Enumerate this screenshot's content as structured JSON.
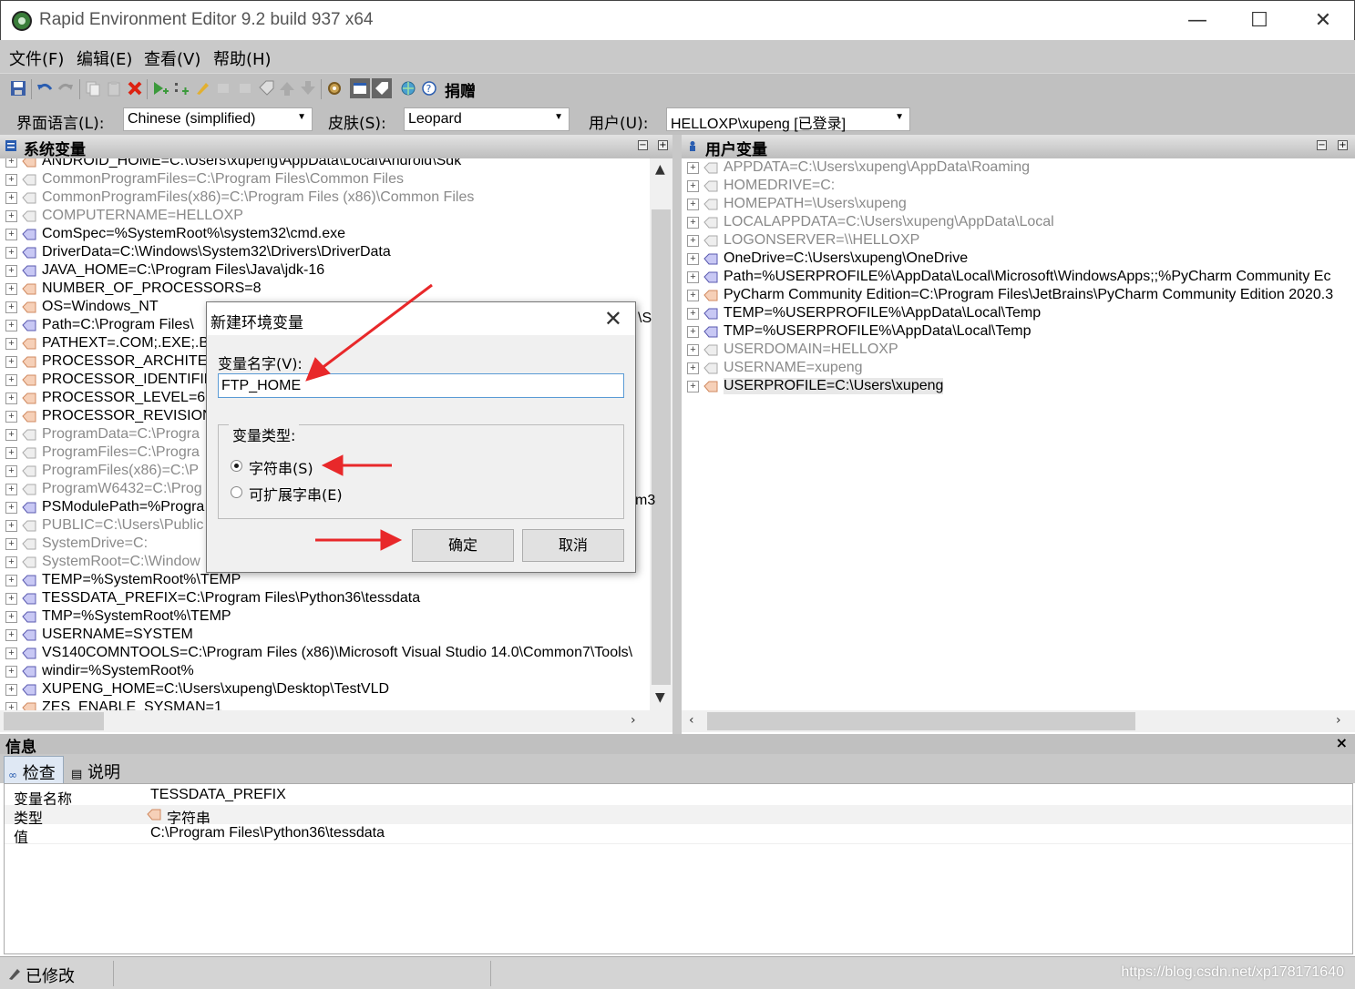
{
  "window": {
    "title": "Rapid Environment Editor 9.2 build 937 x64",
    "minimize": "—",
    "maximize": "☐",
    "close": "✕"
  },
  "menu": [
    "文件(F)",
    "编辑(E)",
    "查看(V)",
    "帮助(H)"
  ],
  "toolbar": {
    "donate": "捐赠",
    "icons": [
      "save-icon",
      "undo-icon",
      "redo-icon",
      "copy-icon",
      "paste-icon",
      "delete-icon",
      "add-variable-icon",
      "add-value-icon",
      "edit-icon",
      "copy-value-icon",
      "paste-value-icon",
      "tag-icon",
      "move-up-icon",
      "move-down-icon",
      "settings-icon",
      "view-icon",
      "tag-view-icon",
      "globe-icon",
      "help-icon"
    ]
  },
  "options": {
    "language_label": "界面语言(L):",
    "language_value": "Chinese (simplified)",
    "skin_label": "皮肤(S):",
    "skin_value": "Leopard",
    "user_label": "用户(U):",
    "user_value": "HELLOXP\\xupeng [已登录]"
  },
  "system_panel": {
    "title": "系统变量",
    "rows": [
      {
        "text": "ANDROID_HOME=C:\\Users\\xupeng\\AppData\\Local\\Android\\Sdk",
        "dim": false
      },
      {
        "text": "CommonProgramFiles=C:\\Program Files\\Common Files",
        "dim": true
      },
      {
        "text": "CommonProgramFiles(x86)=C:\\Program Files (x86)\\Common Files",
        "dim": true
      },
      {
        "text": "COMPUTERNAME=HELLOXP",
        "dim": true
      },
      {
        "text": "ComSpec=%SystemRoot%\\system32\\cmd.exe",
        "dim": false
      },
      {
        "text": "DriverData=C:\\Windows\\System32\\Drivers\\DriverData",
        "dim": false
      },
      {
        "text": "JAVA_HOME=C:\\Program Files\\Java\\jdk-16",
        "dim": false
      },
      {
        "text": "NUMBER_OF_PROCESSORS=8",
        "dim": false
      },
      {
        "text": "OS=Windows_NT",
        "dim": false
      },
      {
        "text": "Path=C:\\Program Files\\",
        "dim": false
      },
      {
        "text": "PATHEXT=.COM;.EXE;.B",
        "dim": false
      },
      {
        "text": "PROCESSOR_ARCHITEC",
        "dim": false
      },
      {
        "text": "PROCESSOR_IDENTIFIE",
        "dim": false
      },
      {
        "text": "PROCESSOR_LEVEL=6",
        "dim": false
      },
      {
        "text": "PROCESSOR_REVISION=",
        "dim": false
      },
      {
        "text": "ProgramData=C:\\Progra",
        "dim": true
      },
      {
        "text": "ProgramFiles=C:\\Progra",
        "dim": true
      },
      {
        "text": "ProgramFiles(x86)=C:\\P",
        "dim": true
      },
      {
        "text": "ProgramW6432=C:\\Prog",
        "dim": true
      },
      {
        "text": "PSModulePath=%Progra",
        "dim": false
      },
      {
        "text": "PUBLIC=C:\\Users\\Public",
        "dim": true
      },
      {
        "text": "SystemDrive=C:",
        "dim": true
      },
      {
        "text": "SystemRoot=C:\\Window",
        "dim": true
      },
      {
        "text": "TEMP=%SystemRoot%\\TEMP",
        "dim": false
      },
      {
        "text": "TESSDATA_PREFIX=C:\\Program Files\\Python36\\tessdata",
        "dim": false
      },
      {
        "text": "TMP=%SystemRoot%\\TEMP",
        "dim": false
      },
      {
        "text": "USERNAME=SYSTEM",
        "dim": false
      },
      {
        "text": "VS140COMNTOOLS=C:\\Program Files (x86)\\Microsoft Visual Studio 14.0\\Common7\\Tools\\",
        "dim": false
      },
      {
        "text": "windir=%SystemRoot%",
        "dim": false
      },
      {
        "text": "XUPENG_HOME=C:\\Users\\xupeng\\Desktop\\TestVLD",
        "dim": false
      },
      {
        "text": "ZES_ENABLE_SYSMAN=1",
        "dim": false
      }
    ],
    "clipped_right": [
      "\\S",
      "m3"
    ]
  },
  "user_panel": {
    "title": "用户变量",
    "rows": [
      {
        "text": "APPDATA=C:\\Users\\xupeng\\AppData\\Roaming",
        "dim": true
      },
      {
        "text": "HOMEDRIVE=C:",
        "dim": true
      },
      {
        "text": "HOMEPATH=\\Users\\xupeng",
        "dim": true
      },
      {
        "text": "LOCALAPPDATA=C:\\Users\\xupeng\\AppData\\Local",
        "dim": true
      },
      {
        "text": "LOGONSERVER=\\\\HELLOXP",
        "dim": true
      },
      {
        "text": "OneDrive=C:\\Users\\xupeng\\OneDrive",
        "dim": false
      },
      {
        "text": "Path=%USERPROFILE%\\AppData\\Local\\Microsoft\\WindowsApps;;%PyCharm Community Ec",
        "dim": false
      },
      {
        "text": "PyCharm Community Edition=C:\\Program Files\\JetBrains\\PyCharm Community Edition 2020.3",
        "dim": false
      },
      {
        "text": "TEMP=%USERPROFILE%\\AppData\\Local\\Temp",
        "dim": false
      },
      {
        "text": "TMP=%USERPROFILE%\\AppData\\Local\\Temp",
        "dim": false
      },
      {
        "text": "USERDOMAIN=HELLOXP",
        "dim": true
      },
      {
        "text": "USERNAME=xupeng",
        "dim": true
      },
      {
        "text": "USERPROFILE=C:\\Users\\xupeng",
        "dim": false
      }
    ]
  },
  "info": {
    "title": "信息",
    "close": "×",
    "tabs": [
      "检查",
      "说明"
    ],
    "rows": [
      {
        "key": "变量名称",
        "value": "TESSDATA_PREFIX"
      },
      {
        "key": "类型",
        "value": "字符串"
      },
      {
        "key": "值",
        "value": "C:\\Program Files\\Python36\\tessdata"
      }
    ]
  },
  "status": {
    "text": "已修改",
    "watermark": "https://blog.csdn.net/xp178171640"
  },
  "dialog": {
    "title": "新建环境变量",
    "close": "✕",
    "name_label": "变量名字(V):",
    "name_value": "FTP_HOME",
    "type_label": "变量类型:",
    "radio_string": "字符串(S)",
    "radio_expand": "可扩展字串(E)",
    "ok": "确定",
    "cancel": "取消"
  },
  "colors": {
    "arrow": "#e8282a",
    "accent": "#5a9bd5"
  }
}
